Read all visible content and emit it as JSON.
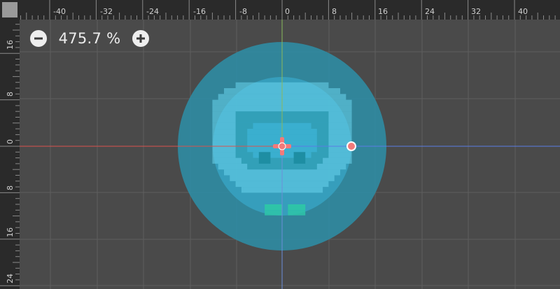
{
  "colors": {
    "viewport_bg": "#4a4a4a",
    "grid_line": "#5e5e5e",
    "ruler_bg": "#2a2a2a",
    "ruler_text": "#d0d0d0",
    "ruler_tick": "#8a8a8a",
    "corner_box": "#9a9a9a",
    "axis_x": "#d9534f",
    "axis_y_top": "#8ab95c",
    "axis_y_bottom": "#6c8fd9",
    "guide_line": "#5b7ce6",
    "shape_outer": "#2d8fa8",
    "shape_inner": "#38a7c7",
    "sprite_light": "#6ad4ec",
    "sprite_mid": "#3cb3d4",
    "sprite_dark": "#1e8ea3",
    "sprite_feet": "#2ec4a8",
    "handle_fill": "#f27a7a",
    "handle_stroke": "#ffffff"
  },
  "zoom": {
    "zoom_out_icon": "minus-icon",
    "zoom_in_icon": "plus-icon",
    "level_text": "475.7 %"
  },
  "ruler": {
    "top_labels": [
      "-40",
      "-32",
      "-24",
      "-16",
      "-8",
      "0",
      "8",
      "16",
      "24",
      "32",
      "40"
    ],
    "left_labels": [
      "16",
      "8",
      "0",
      "8",
      "16",
      "24"
    ]
  },
  "handles": {
    "pivot_icon": "pivot-cross-icon",
    "radius_handle_icon": "circle-handle-icon"
  }
}
